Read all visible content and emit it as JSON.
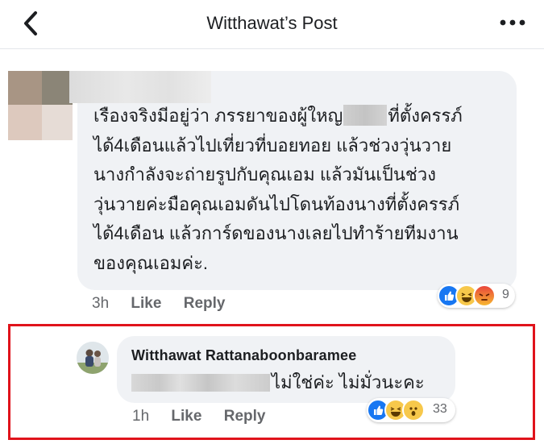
{
  "header": {
    "title": "Witthawat’s Post"
  },
  "comment1": {
    "lines": [
      "เรืองจริงมีอยู่ว่า ภรรยาของผู้ใหญ",
      "ที่ตั้งครรภ์",
      "ได้4เดือนแล้วไปเที่ยวที่บอยทอย แล้วช่วงวุ่นวาย",
      "นางกำลังจะถ่ายรูปกับคุณเอม แล้วมันเป็นช่วง",
      "วุ่นวายค่ะมือคุณเอมดันไปโดนท้องนางที่ตั้งครรภ์",
      "ได้4เดือน แล้วการ์ดของนางเลยไปทำร้ายทีมงาน",
      "ของคุณเอมค่ะ."
    ],
    "time": "3h",
    "like_label": "Like",
    "reply_label": "Reply",
    "reactions": [
      "like",
      "haha",
      "angry"
    ],
    "reaction_count": "9"
  },
  "comment2": {
    "author": "Witthawat Rattanaboonbaramee",
    "text": "ไม่ใช่ค่ะ ไม่มั่วนะคะ",
    "time": "1h",
    "like_label": "Like",
    "reply_label": "Reply",
    "reactions": [
      "like",
      "haha",
      "wow"
    ],
    "reaction_count": "33"
  },
  "colors": {
    "highlight_border": "#e0131b",
    "bubble": "#f0f2f5",
    "meta_text": "#65676b",
    "like_blue": "#1877f2"
  }
}
